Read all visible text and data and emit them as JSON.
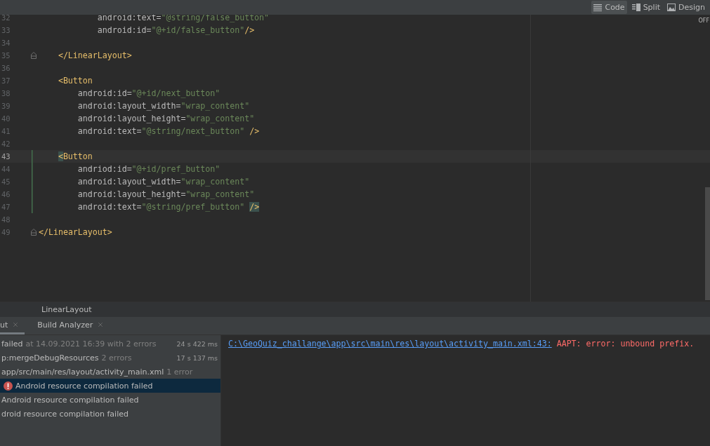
{
  "editor_modes": [
    {
      "label": "Code",
      "selected": true
    },
    {
      "label": "Split",
      "selected": false
    },
    {
      "label": "Design",
      "selected": false
    }
  ],
  "power_save_label": "OFF",
  "code_lines": [
    {
      "children": [
        {
          "children": [
            {
              "children": [
                {
                  "number": "32",
                  "current": false,
                  "fold_marker": false,
                  "changed": false,
                  "tokens": [
                    {
                      "kind": "attr",
                      "text": "android:text="
                    },
                    {
                      "kind": "value",
                      "text": "\"@string/false_button\""
                    }
                  ]
                },
                {
                  "number": "33",
                  "current": false,
                  "fold_marker": false,
                  "changed": false,
                  "tokens": [
                    {
                      "kind": "attr",
                      "text": "android:id="
                    },
                    {
                      "kind": "value",
                      "text": "\"@+id/false_button\""
                    },
                    {
                      "kind": "tag",
                      "text": "/>"
                    }
                  ]
                }
              ]
            }
          ]
        },
        {
          "number": "34",
          "current": false,
          "fold_marker": false,
          "changed": false
        },
        {
          "number": "35",
          "current": false,
          "fold_marker": true,
          "changed": false,
          "tokens": [
            {
              "kind": "tag",
              "text": "</LinearLayout>"
            }
          ]
        },
        {
          "number": "36",
          "current": false,
          "fold_marker": false,
          "changed": false
        },
        {
          "number": "37",
          "current": false,
          "fold_marker": false,
          "changed": false,
          "tokens": [
            {
              "kind": "tag",
              "text": "<Button"
            }
          ],
          "children": [
            {
              "number": "38",
              "current": false,
              "fold_marker": false,
              "changed": false,
              "tokens": [
                {
                  "kind": "attr",
                  "text": "android:id="
                },
                {
                  "kind": "value",
                  "text": "\"@+id/next_button\""
                }
              ]
            },
            {
              "number": "39",
              "current": false,
              "fold_marker": false,
              "changed": false,
              "tokens": [
                {
                  "kind": "attr",
                  "text": "android:layout_width="
                },
                {
                  "kind": "value",
                  "text": "\"wrap_content\""
                }
              ]
            },
            {
              "number": "40",
              "current": false,
              "fold_marker": false,
              "changed": false,
              "tokens": [
                {
                  "kind": "attr",
                  "text": "android:layout_height="
                },
                {
                  "kind": "value",
                  "text": "\"wrap_content\""
                }
              ]
            },
            {
              "number": "41",
              "current": false,
              "fold_marker": false,
              "changed": false,
              "tokens": [
                {
                  "kind": "attr",
                  "text": "android:text="
                },
                {
                  "kind": "value",
                  "text": "\"@string/next_button\""
                },
                {
                  "kind": "tag",
                  "text": " />"
                }
              ]
            }
          ]
        },
        {
          "number": "42",
          "current": false,
          "fold_marker": false,
          "changed": false
        },
        {
          "number": "43",
          "current": true,
          "fold_marker": false,
          "changed": true,
          "tokens": [
            {
              "kind": "match",
              "text": "<"
            },
            {
              "kind": "tag",
              "text": "Button"
            }
          ],
          "children": [
            {
              "number": "44",
              "current": false,
              "fold_marker": false,
              "changed": true,
              "tokens": [
                {
                  "kind": "attr",
                  "text": "andriod:id="
                },
                {
                  "kind": "value",
                  "text": "\"@+id/pref_button\""
                }
              ]
            },
            {
              "number": "45",
              "current": false,
              "fold_marker": false,
              "changed": true,
              "tokens": [
                {
                  "kind": "attr",
                  "text": "android:layout_width="
                },
                {
                  "kind": "value",
                  "text": "\"wrap_content\""
                }
              ]
            },
            {
              "number": "46",
              "current": false,
              "fold_marker": false,
              "changed": true,
              "tokens": [
                {
                  "kind": "attr",
                  "text": "android:layout_height="
                },
                {
                  "kind": "value",
                  "text": "\"wrap_content\""
                }
              ]
            },
            {
              "number": "47",
              "current": false,
              "fold_marker": false,
              "changed": true,
              "tokens": [
                {
                  "kind": "attr",
                  "text": "android:text="
                },
                {
                  "kind": "value",
                  "text": "\"@string/pref_button\""
                },
                {
                  "kind": "match",
                  "text": " />"
                }
              ]
            }
          ]
        },
        {
          "number": "48",
          "current": false,
          "fold_marker": false,
          "changed": false
        }
      ]
    },
    {
      "number": "49",
      "current": false,
      "fold_marker": true,
      "changed": false,
      "tokens": [
        {
          "kind": "tag",
          "text": "</LinearLayout>"
        }
      ]
    }
  ],
  "breadcrumb": "LinearLayout",
  "tool_tabs": [
    {
      "label": "ut",
      "selected": true
    },
    {
      "label": "Build Analyzer",
      "selected": false
    }
  ],
  "build_tree": [
    {
      "kind": "plain",
      "selected": false,
      "text": "failed",
      "detail": "at 14.09.2021 16:39 with 2 errors",
      "time": "24 s 422 ms"
    },
    {
      "kind": "plain",
      "selected": false,
      "text": "p:mergeDebugResources",
      "detail": "2 errors",
      "time": "17 s 137 ms"
    },
    {
      "kind": "plain",
      "selected": false,
      "text": "app/src/main/res/layout/activity_main.xml",
      "detail": "1 error"
    },
    {
      "kind": "error",
      "selected": true,
      "text": "Android resource compilation failed"
    },
    {
      "kind": "plain",
      "selected": false,
      "text": "Android resource compilation failed"
    },
    {
      "kind": "plain",
      "selected": false,
      "text": "droid resource compilation failed"
    }
  ],
  "console": {
    "link": "C:\\GeoQuiz_challange\\app\\src\\main\\res\\layout\\activity_main.xml:43:",
    "message": "AAPT: error: unbound prefix."
  }
}
